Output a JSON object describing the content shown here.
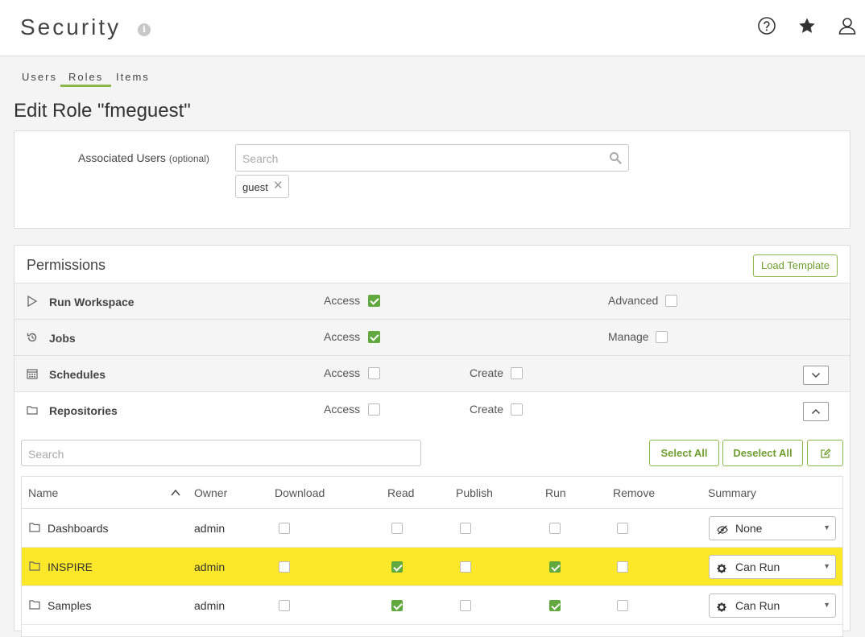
{
  "header": {
    "title": "Security",
    "icons": [
      "help-icon",
      "star-icon",
      "user-icon"
    ]
  },
  "tabs": [
    {
      "label": "Users",
      "active": false
    },
    {
      "label": "Roles",
      "active": true
    },
    {
      "label": "Items",
      "active": false
    }
  ],
  "edit_title": "Edit Role \"fmeguest\"",
  "associated_users": {
    "label": "Associated Users",
    "optional": "(optional)",
    "placeholder": "Search",
    "tags": [
      "guest"
    ]
  },
  "permissions": {
    "title": "Permissions",
    "load_template": "Load Template",
    "rows": [
      {
        "label": "Run Workspace",
        "icon": "play-icon",
        "options": [
          {
            "label": "Access",
            "checked": true
          },
          {
            "label": "Advanced",
            "checked": false
          }
        ]
      },
      {
        "label": "Jobs",
        "icon": "history-icon",
        "options": [
          {
            "label": "Access",
            "checked": true
          },
          {
            "label": "Manage",
            "checked": false
          }
        ]
      },
      {
        "label": "Schedules",
        "icon": "calendar-icon",
        "options": [
          {
            "label": "Access",
            "checked": false
          },
          {
            "label": "Create",
            "checked": false
          }
        ]
      },
      {
        "label": "Repositories",
        "icon": "folder-icon",
        "options": [
          {
            "label": "Access",
            "checked": false
          },
          {
            "label": "Create",
            "checked": false
          }
        ]
      }
    ]
  },
  "repositories": {
    "search_placeholder": "Search",
    "select_all": "Select All",
    "deselect_all": "Deselect All",
    "columns": [
      "Name",
      "Owner",
      "Download",
      "Read",
      "Publish",
      "Run",
      "Remove",
      "Summary"
    ],
    "rows": [
      {
        "name": "Dashboards",
        "owner": "admin",
        "download": false,
        "read": false,
        "publish": false,
        "run": false,
        "remove": false,
        "summary": "None",
        "summary_icon": "eye-slash-icon",
        "highlight": false
      },
      {
        "name": "INSPIRE",
        "owner": "admin",
        "download": false,
        "read": true,
        "publish": false,
        "run": true,
        "remove": false,
        "summary": "Can Run",
        "summary_icon": "gear-icon",
        "highlight": true
      },
      {
        "name": "Samples",
        "owner": "admin",
        "download": false,
        "read": true,
        "publish": false,
        "run": true,
        "remove": false,
        "summary": "Can Run",
        "summary_icon": "gear-icon",
        "highlight": false
      }
    ]
  },
  "colors": {
    "accent": "#8ab84a",
    "check": "#61a83e",
    "highlight": "#fce828"
  }
}
